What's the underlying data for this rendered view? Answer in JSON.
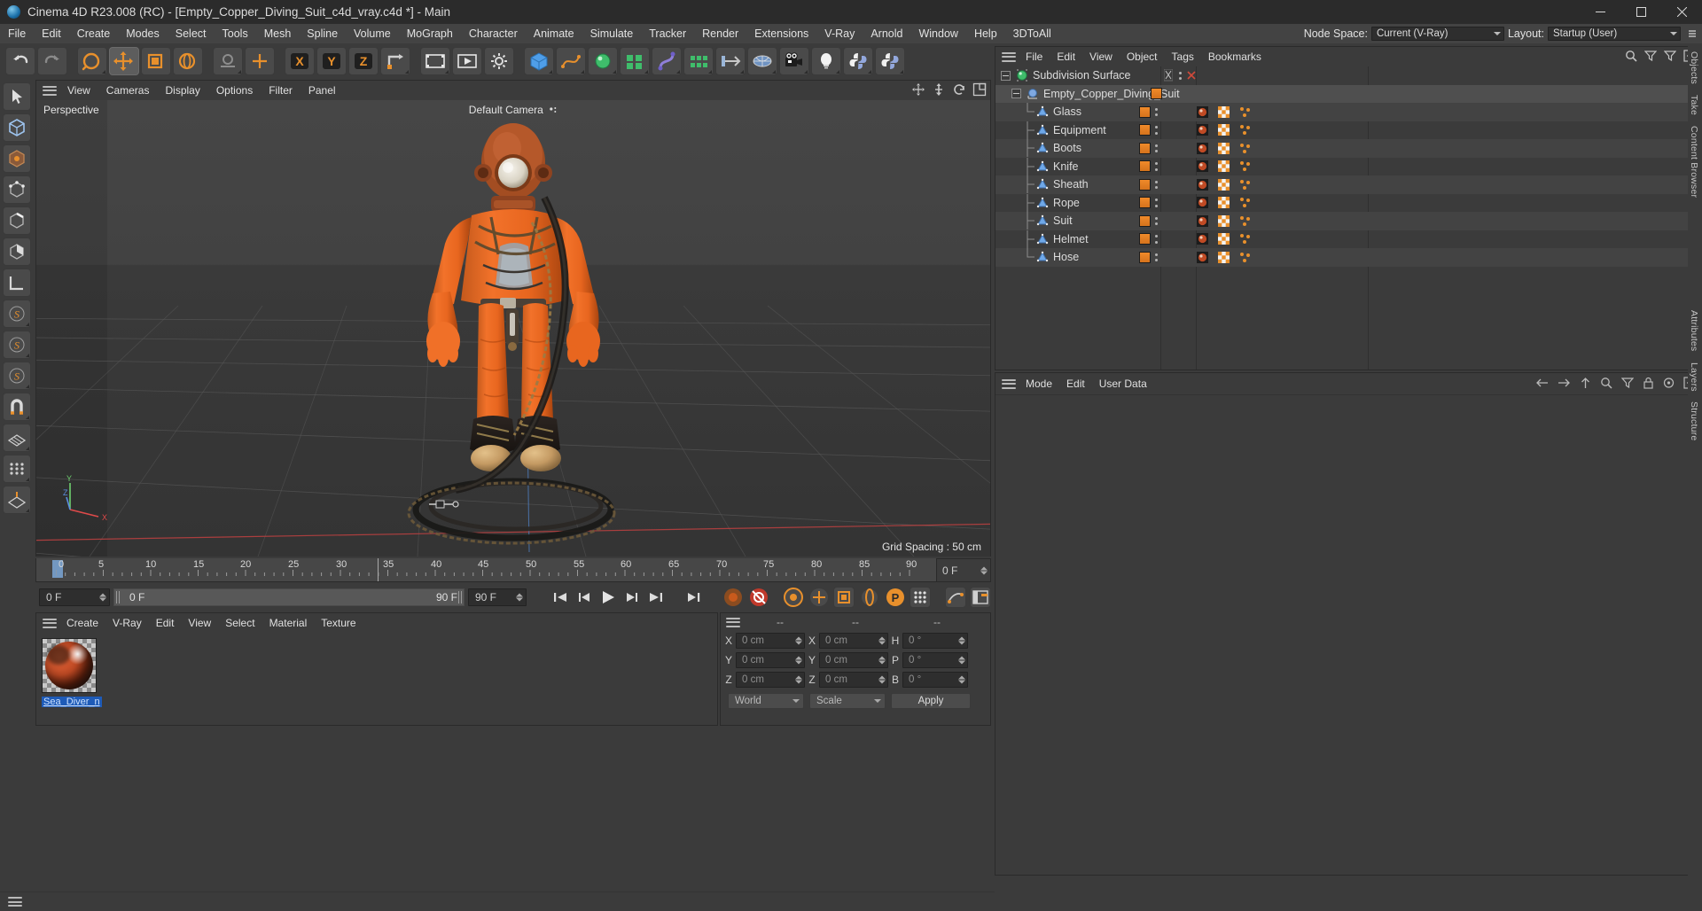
{
  "window": {
    "title": "Cinema 4D R23.008 (RC) - [Empty_Copper_Diving_Suit_c4d_vray.c4d *] - Main",
    "minimize_label": "minimize",
    "maximize_label": "maximize",
    "close_label": "close"
  },
  "menubar": {
    "items": [
      "File",
      "Edit",
      "Create",
      "Modes",
      "Select",
      "Tools",
      "Mesh",
      "Spline",
      "Volume",
      "MoGraph",
      "Character",
      "Animate",
      "Simulate",
      "Tracker",
      "Render",
      "Extensions",
      "V-Ray",
      "Arnold",
      "Window",
      "Help",
      "3DToAll"
    ],
    "node_space_label": "Node Space:",
    "node_space_value": "Current (V-Ray)",
    "layout_label": "Layout:",
    "layout_value": "Startup (User)"
  },
  "toolbar": {
    "buttons": [
      {
        "name": "undo-button",
        "icon": "undo"
      },
      {
        "name": "redo-button",
        "icon": "redo"
      },
      {
        "name": "live-selection-button",
        "icon": "live-selection"
      },
      {
        "name": "move-button",
        "icon": "move"
      },
      {
        "name": "scale-button",
        "icon": "scale"
      },
      {
        "name": "rotate-button",
        "icon": "rotate"
      },
      {
        "name": "dynamic-place-button",
        "icon": "dynamic-place"
      },
      {
        "name": "axis-move-button",
        "icon": "axis-move"
      },
      {
        "name": "lock-x-button",
        "icon": "x-axis"
      },
      {
        "name": "lock-y-button",
        "icon": "y-axis"
      },
      {
        "name": "lock-z-button",
        "icon": "z-axis"
      },
      {
        "name": "world-coordinate-button",
        "icon": "world-axis"
      },
      {
        "name": "render-view-button",
        "icon": "render-view"
      },
      {
        "name": "render-to-picture-viewer-button",
        "icon": "render-picture-viewer"
      },
      {
        "name": "render-settings-button",
        "icon": "render-settings"
      },
      {
        "name": "add-cube-button",
        "icon": "cube"
      },
      {
        "name": "add-spline-button",
        "icon": "spline-pen"
      },
      {
        "name": "generators-button",
        "icon": "subdivision-surface"
      },
      {
        "name": "scene-nodes-button",
        "icon": "array"
      },
      {
        "name": "deformers-button",
        "icon": "bend-deformer"
      },
      {
        "name": "mograph-button",
        "icon": "cloner"
      },
      {
        "name": "field-button",
        "icon": "field"
      },
      {
        "name": "environment-button",
        "icon": "floor"
      },
      {
        "name": "camera-button",
        "icon": "camera"
      },
      {
        "name": "light-button",
        "icon": "light"
      },
      {
        "name": "python-generator-button",
        "icon": "python"
      },
      {
        "name": "python-tag-button",
        "icon": "python"
      }
    ]
  },
  "left_toolbar": {
    "buttons": [
      {
        "name": "model-mode-button",
        "icon": "cursor"
      },
      {
        "name": "object-mode-button",
        "icon": "object-cube"
      },
      {
        "name": "texture-mode-button",
        "icon": "texture"
      },
      {
        "name": "points-mode-button",
        "icon": "points"
      },
      {
        "name": "edges-mode-button",
        "icon": "edges"
      },
      {
        "name": "polygons-mode-button",
        "icon": "polygons"
      },
      {
        "name": "workplane-mode-button",
        "icon": "workplane"
      },
      {
        "name": "enable-axis-button",
        "icon": "axis-s"
      },
      {
        "name": "lock-axis-button",
        "icon": "axis-s2"
      },
      {
        "name": "viewport-solo-button",
        "icon": "axis-s3"
      },
      {
        "name": "snap-button",
        "icon": "magnet"
      },
      {
        "name": "workplane-lock-button",
        "icon": "grid-plane"
      },
      {
        "name": "quantize-button",
        "icon": "grid-dots"
      },
      {
        "name": "world-grid-button",
        "icon": "grid-world"
      }
    ]
  },
  "viewport": {
    "menu": [
      "View",
      "Cameras",
      "Display",
      "Options",
      "Filter",
      "Panel"
    ],
    "perspective_label": "Perspective",
    "camera_label": "Default Camera",
    "grid_spacing_label": "Grid Spacing : 50 cm",
    "axis_labels": {
      "x": "X",
      "y": "Y",
      "z": "Z"
    }
  },
  "timeline": {
    "ticks": [
      0,
      5,
      10,
      15,
      20,
      25,
      30,
      35,
      40,
      45,
      50,
      55,
      60,
      65,
      70,
      75,
      80,
      85,
      90
    ],
    "current_frame_field": "0 F",
    "playhead_frame": 0
  },
  "transport": {
    "current_frame": "0 F",
    "range_start": "0 F",
    "range_end_left": "90 F",
    "range_end_field": "90 F",
    "buttons": [
      {
        "name": "go-to-start-button",
        "icon": "skip-start"
      },
      {
        "name": "step-back-button",
        "icon": "step-back"
      },
      {
        "name": "play-button",
        "icon": "play"
      },
      {
        "name": "step-forward-button",
        "icon": "step-forward"
      },
      {
        "name": "go-to-end-button",
        "icon": "skip-end"
      },
      {
        "name": "go-to-next-key-button",
        "icon": "next-key"
      },
      {
        "name": "record-active-objects-button",
        "icon": "record-dot"
      },
      {
        "name": "autokeying-button",
        "icon": "autokey"
      },
      {
        "name": "keyframe-selection-button",
        "icon": "keyframe-select"
      },
      {
        "name": "position-key-button",
        "icon": "pos-key"
      },
      {
        "name": "scale-key-button",
        "icon": "scale-key"
      },
      {
        "name": "rotation-key-button",
        "icon": "rot-key"
      },
      {
        "name": "param-key-button",
        "icon": "param-key"
      },
      {
        "name": "pla-key-button",
        "icon": "pla-key"
      },
      {
        "name": "animation-mode-button",
        "icon": "anim-mode"
      },
      {
        "name": "timeline-mode-button",
        "icon": "timeline-mode"
      }
    ]
  },
  "material_manager": {
    "menu": [
      "Create",
      "V-Ray",
      "Edit",
      "View",
      "Select",
      "Material",
      "Texture"
    ],
    "materials": [
      {
        "name": "Sea_Diver_n"
      }
    ]
  },
  "coordinates": {
    "header": [
      "--",
      "--",
      "--"
    ],
    "rows": [
      {
        "axis1": "X",
        "value1": "0 cm",
        "axis2": "X",
        "value2": "0 cm",
        "axis3": "H",
        "value3": "0 °"
      },
      {
        "axis1": "Y",
        "value1": "0 cm",
        "axis2": "Y",
        "value2": "0 cm",
        "axis3": "P",
        "value3": "0 °"
      },
      {
        "axis1": "Z",
        "value1": "0 cm",
        "axis2": "Z",
        "value2": "0 cm",
        "axis3": "B",
        "value3": "0 °"
      }
    ],
    "system_select": "World",
    "mode_select": "Scale",
    "apply_label": "Apply"
  },
  "object_manager": {
    "menu": [
      "File",
      "Edit",
      "View",
      "Object",
      "Tags",
      "Bookmarks"
    ],
    "items": [
      {
        "name": "Subdivision Surface",
        "depth": 0,
        "icon": "subdivision-surface",
        "selected": false,
        "has_tags": false,
        "expander": true
      },
      {
        "name": "Empty_Copper_Diving_Suit",
        "depth": 1,
        "icon": "null-object",
        "selected": true,
        "has_tags": false,
        "expander": true,
        "tag_orange": true
      },
      {
        "name": "Glass",
        "depth": 2,
        "icon": "polygon-object",
        "selected": false,
        "has_tags": true
      },
      {
        "name": "Equipment",
        "depth": 2,
        "icon": "polygon-object",
        "selected": false,
        "has_tags": true
      },
      {
        "name": "Boots",
        "depth": 2,
        "icon": "polygon-object",
        "selected": false,
        "has_tags": true
      },
      {
        "name": "Knife",
        "depth": 2,
        "icon": "polygon-object",
        "selected": false,
        "has_tags": true
      },
      {
        "name": "Sheath",
        "depth": 2,
        "icon": "polygon-object",
        "selected": false,
        "has_tags": true
      },
      {
        "name": "Rope",
        "depth": 2,
        "icon": "polygon-object",
        "selected": false,
        "has_tags": true
      },
      {
        "name": "Suit",
        "depth": 2,
        "icon": "polygon-object",
        "selected": false,
        "has_tags": true
      },
      {
        "name": "Helmet",
        "depth": 2,
        "icon": "polygon-object",
        "selected": false,
        "has_tags": true
      },
      {
        "name": "Hose",
        "depth": 2,
        "icon": "polygon-object",
        "selected": false,
        "has_tags": true
      }
    ]
  },
  "attribute_manager": {
    "menu": [
      "Mode",
      "Edit",
      "User Data"
    ]
  },
  "right_dock": {
    "tabs": [
      "Objects",
      "Take",
      "Content Browser",
      "Attributes",
      "Layers",
      "Structure"
    ]
  },
  "status_bar": {
    "message": ""
  },
  "colors": {
    "accent_orange": "#f08a2a",
    "panel_bg": "#3b3b3b",
    "menubar_bg": "#434343",
    "titlebar_bg": "#2b2b2b",
    "selection_blue": "#1e5bb8",
    "axis_x": "#e04a4a",
    "axis_y": "#6fd06f",
    "axis_z": "#5b8fe0"
  }
}
